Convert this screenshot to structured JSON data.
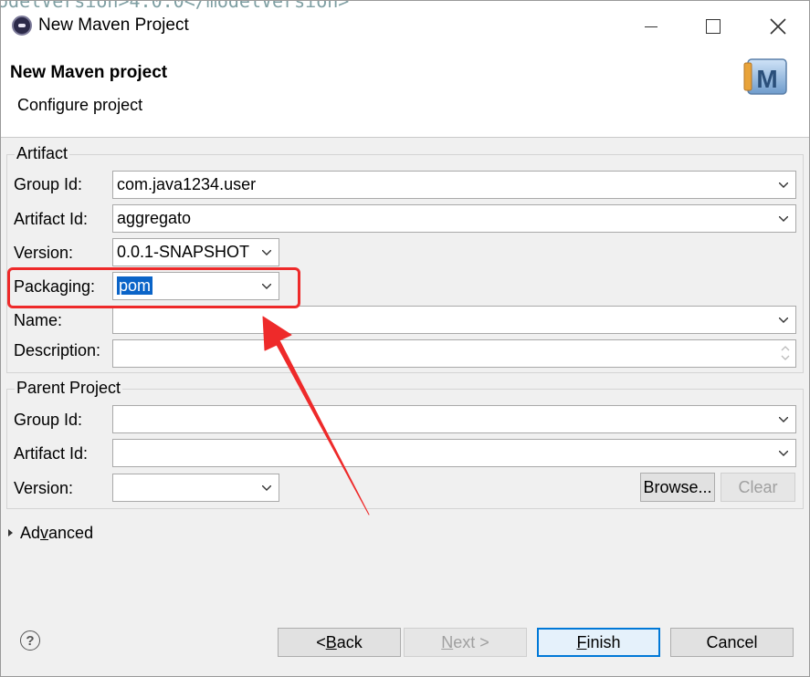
{
  "window": {
    "title": "New Maven Project",
    "code_peek": "odelVersion>4.0.0</modelVersion>"
  },
  "banner": {
    "title": "New Maven project",
    "subtitle": "Configure project",
    "icon_letter": "M"
  },
  "artifact": {
    "legend": "Artifact",
    "group_id_label": "Group Id:",
    "group_id_value": "com.java1234.user",
    "artifact_id_label": "Artifact Id:",
    "artifact_id_value": "aggregato",
    "version_label": "Version:",
    "version_value": "0.0.1-SNAPSHOT",
    "packaging_label": "Packaging:",
    "packaging_value": "pom",
    "name_label": "Name:",
    "name_value": "",
    "description_label": "Description:",
    "description_value": ""
  },
  "parent": {
    "legend": "Parent Project",
    "group_id_label": "Group Id:",
    "group_id_value": "",
    "artifact_id_label": "Artifact Id:",
    "artifact_id_value": "",
    "version_label": "Version:",
    "version_value": "",
    "browse_label": "Browse...",
    "clear_label": "Clear"
  },
  "advanced": {
    "label_pre": "Ad",
    "label_accel": "v",
    "label_post": "anced"
  },
  "buttons": {
    "back_pre": "< ",
    "back_accel": "B",
    "back_post": "ack",
    "next_pre": "",
    "next_accel": "N",
    "next_post": "ext >",
    "finish_pre": "",
    "finish_accel": "F",
    "finish_post": "inish",
    "cancel": "Cancel"
  },
  "colors": {
    "annotation": "#ee2a2a",
    "selection": "#0a64c8",
    "default_button_border": "#0078d7"
  }
}
